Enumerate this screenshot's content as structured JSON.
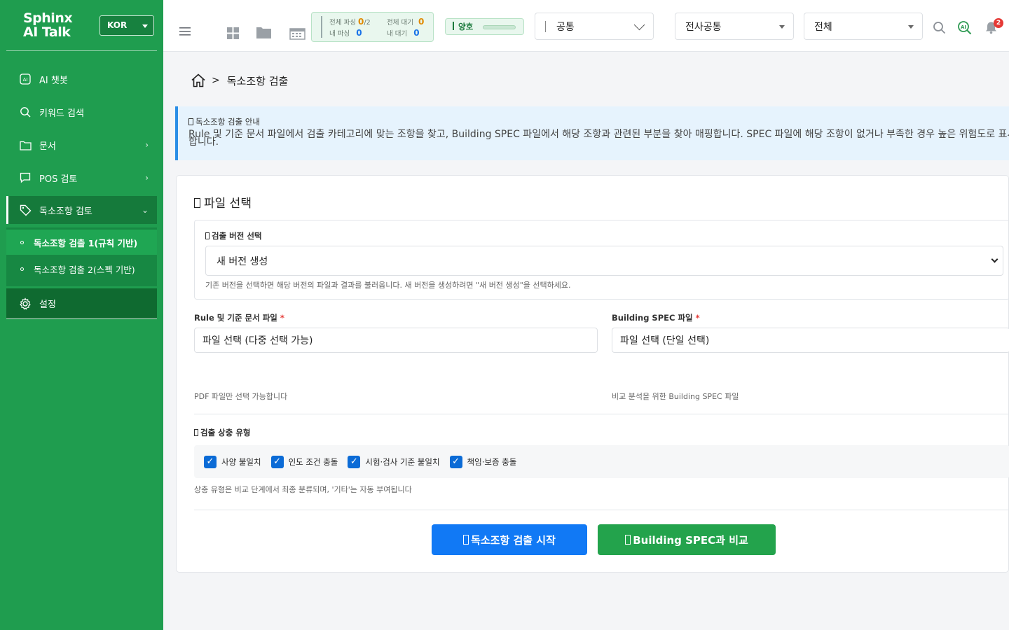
{
  "brand": {
    "line1": "Sphinx",
    "line2": "AI Talk"
  },
  "language": {
    "selected": "KOR"
  },
  "sidebar": {
    "items": [
      {
        "label": "AI 챗봇"
      },
      {
        "label": "키워드 검색"
      },
      {
        "label": "문서",
        "chevron": "›"
      },
      {
        "label": "POS 검토",
        "chevron": "›"
      },
      {
        "label": "독소조항 검토",
        "chevron": "⌄"
      }
    ],
    "subitems": [
      {
        "label": "독소조항 검출 1(규칙 기반)"
      },
      {
        "label": "독소조항 검출 2(스펙 기반)"
      }
    ],
    "settings": "설정"
  },
  "topbar": {
    "stats": {
      "total_parse_label": "전체 파싱",
      "total_parse_value": "0",
      "total_parse_max": "/2",
      "my_parse_label": "내 파싱",
      "my_parse_value": "0",
      "total_wait_label": "전체 대기",
      "total_wait_value": "0",
      "my_wait_label": "내 대기",
      "my_wait_value": "0"
    },
    "status_label": "양호",
    "select1": "공통",
    "select2": "전사공통",
    "select3": "전체",
    "notification_count": "2"
  },
  "breadcrumb": {
    "current": "독소조항 검출",
    "separator": ">"
  },
  "notice": {
    "title": "독소조항 검출 안내",
    "text": "Rule 및 기준 문서 파일에서 검출 카테고리에 맞는 조항을 찾고, Building SPEC 파일에서 해당 조항과 관련된 부분을 찾아 매핑합니다. SPEC 파일에 해당 조항이 없거나 부족한 경우 높은 위험도로 표시합니다."
  },
  "card": {
    "title": "파일 선택",
    "version": {
      "label": "검출 버전 선택",
      "selected": "새 버전 생성",
      "hint": "기존 버전을 선택하면 해당 버전의 파일과 결과를 불러옵니다. 새 버전을 생성하려면 \"새 버전 생성\"을 선택하세요."
    },
    "rule_file": {
      "label": "Rule 및 기준 문서 파일",
      "required": "*",
      "value": "파일 선택 (다중 선택 가능)",
      "hint": "PDF 파일만 선택 가능합니다"
    },
    "spec_file": {
      "label": "Building SPEC 파일",
      "required": "*",
      "value": "파일 선택 (단일 선택)",
      "hint": "비교 분석을 위한 Building SPEC 파일"
    },
    "conflict": {
      "label": "검출 상충 유형",
      "options": [
        {
          "label": "사양 불일치",
          "checked": true
        },
        {
          "label": "인도 조건 충돌",
          "checked": true
        },
        {
          "label": "시험·검사 기준 불일치",
          "checked": true
        },
        {
          "label": "책임·보증 충돌",
          "checked": true
        }
      ],
      "hint": "상충 유형은 비교 단계에서 최종 분류되며, '기타'는 자동 부여됩니다"
    },
    "start_button": "독소조항 검출 시작",
    "compare_button": "Building SPEC과 비교"
  },
  "colors": {
    "sidebar": "#1f9d4f",
    "primary_button": "#1179f5",
    "secondary_button": "#23a34c",
    "notice_border": "#2b8ee6"
  }
}
